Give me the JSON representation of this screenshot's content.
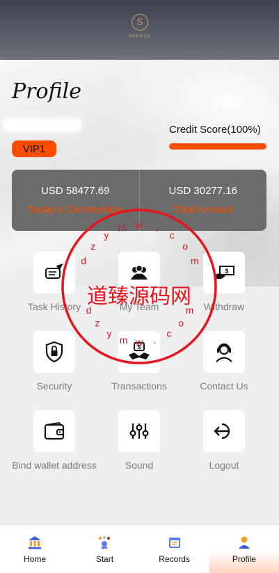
{
  "header": {
    "logo_letter": "S",
    "logo_text": "SSENSE"
  },
  "profile": {
    "title": "Profile",
    "vip_level": "VIP1",
    "credit_label": "Credit Score(100%)",
    "credit_score": 1.0
  },
  "stats": [
    {
      "value": "USD 58477.69",
      "label": "Today's Commission"
    },
    {
      "value": "USD 30277.16",
      "label": "Total Amount"
    }
  ],
  "menu": [
    {
      "label": "Task History",
      "icon": "scroll-quill-icon"
    },
    {
      "label": "My Team",
      "icon": "team-icon"
    },
    {
      "label": "Withdraw",
      "icon": "cash-icon"
    },
    {
      "label": "Security",
      "icon": "shield-lock-icon"
    },
    {
      "label": "Transactions",
      "icon": "handshake-icon"
    },
    {
      "label": "Contact Us",
      "icon": "headset-icon"
    },
    {
      "label": "Bind wallet address",
      "icon": "wallet-icon"
    },
    {
      "label": "Sound",
      "icon": "sliders-icon"
    },
    {
      "label": "Logout",
      "icon": "logout-icon"
    }
  ],
  "watermark": {
    "title": "道臻源码网",
    "text": "dzymw.com"
  },
  "nav": [
    {
      "label": "Home",
      "icon": "bank-icon"
    },
    {
      "label": "Start",
      "icon": "start-icon"
    },
    {
      "label": "Records",
      "icon": "records-icon"
    },
    {
      "label": "Profile",
      "icon": "user-icon"
    }
  ],
  "colors": {
    "accent": "#ff4d00",
    "card": "#6b6b6b",
    "watermark": "#e8141d"
  }
}
